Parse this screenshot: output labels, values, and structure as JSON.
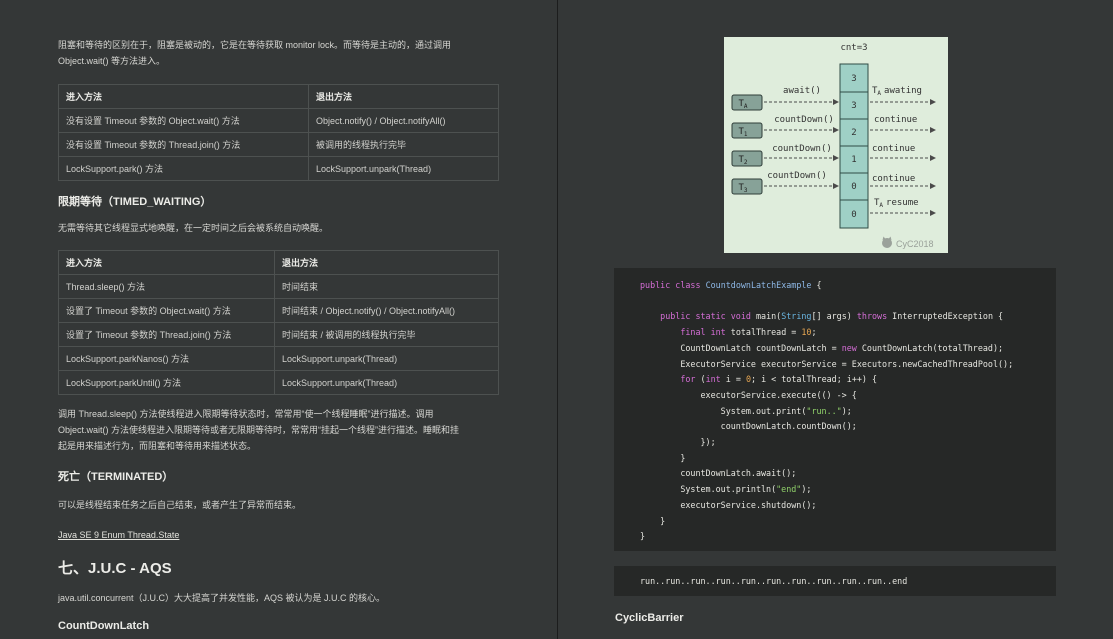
{
  "left": {
    "intro_line1": "阻塞和等待的区别在于，阻塞是被动的，它是在等待获取 monitor lock。而等待是主动的，通过调用",
    "intro_line2": "Object.wait() 等方法进入。",
    "table1": {
      "headers": [
        "进入方法",
        "退出方法"
      ],
      "rows": [
        [
          "没有设置 Timeout 参数的 Object.wait() 方法",
          "Object.notify() / Object.notifyAll()"
        ],
        [
          "没有设置 Timeout 参数的 Thread.join() 方法",
          "被调用的线程执行完毕"
        ],
        [
          "LockSupport.park() 方法",
          "LockSupport.unpark(Thread)"
        ]
      ]
    },
    "timed_heading": "限期等待（TIMED_WAITING）",
    "timed_desc": "无需等待其它线程显式地唤醒，在一定时间之后会被系统自动唤醒。",
    "table2": {
      "headers": [
        "进入方法",
        "退出方法"
      ],
      "rows": [
        [
          "Thread.sleep() 方法",
          "时间结束"
        ],
        [
          "设置了 Timeout 参数的 Object.wait() 方法",
          "时间结束 / Object.notify() / Object.notifyAll()"
        ],
        [
          "设置了 Timeout 参数的 Thread.join() 方法",
          "时间结束 / 被调用的线程执行完毕"
        ],
        [
          "LockSupport.parkNanos() 方法",
          "LockSupport.unpark(Thread)"
        ],
        [
          "LockSupport.parkUntil() 方法",
          "LockSupport.unpark(Thread)"
        ]
      ]
    },
    "sleep_line1": "调用 Thread.sleep() 方法使线程进入限期等待状态时，常常用“使一个线程睡眠”进行描述。调用",
    "sleep_line2": "Object.wait() 方法使线程进入限期等待或者无限期等待时，常常用“挂起一个线程”进行描述。睡眠和挂",
    "sleep_line3": "起是用来描述行为，而阻塞和等待用来描述状态。",
    "terminated_heading": "死亡（TERMINATED）",
    "terminated_desc": "可以是线程结束任务之后自己结束，或者产生了异常而结束。",
    "link_text": "Java SE 9 Enum Thread.State",
    "section_heading": "七、J.U.C - AQS",
    "juc_desc": "java.util.concurrent（J.U.C）大大提高了并发性能，AQS 被认为是 J.U.C 的核心。",
    "countdown_heading": "CountDownLatch"
  },
  "diagram": {
    "title": "cnt=3",
    "counter_cells": [
      "3",
      "3",
      "2",
      "1",
      "0",
      "0"
    ],
    "threads": [
      "T",
      "T",
      "T",
      "T"
    ],
    "thread_subs": [
      "A",
      "1",
      "2",
      "3"
    ],
    "left_labels": [
      "await()",
      "countDown()",
      "countDown()",
      "countDown()"
    ],
    "right_labels": [
      "awating",
      "continue",
      "continue",
      "continue",
      "resume"
    ],
    "t_prefix": "T",
    "t_sub": "A",
    "watermark": "CyC2018"
  },
  "right": {
    "code_lines": [
      "public class CountdownLatchExample {",
      "",
      "    public static void main(String[] args) throws InterruptedException {",
      "        final int totalThread = 10;",
      "        CountDownLatch countDownLatch = new CountDownLatch(totalThread);",
      "        ExecutorService executorService = Executors.newCachedThreadPool();",
      "        for (int i = 0; i < totalThread; i++) {",
      "            executorService.execute(() -> {",
      "                System.out.print(\"run..\");",
      "                countDownLatch.countDown();",
      "            });",
      "        }",
      "        countDownLatch.await();",
      "        System.out.println(\"end\");",
      "        executorService.shutdown();",
      "    }",
      "}"
    ],
    "output": "run..run..run..run..run..run..run..run..run..run..end",
    "next_heading": "CyclicBarrier"
  },
  "colors": {
    "background": "#343737",
    "diagram_bg": "#dfeddc",
    "counter_fill": "#9fd0c6",
    "keyword": "#d56ed6",
    "string": "#90d16a"
  }
}
